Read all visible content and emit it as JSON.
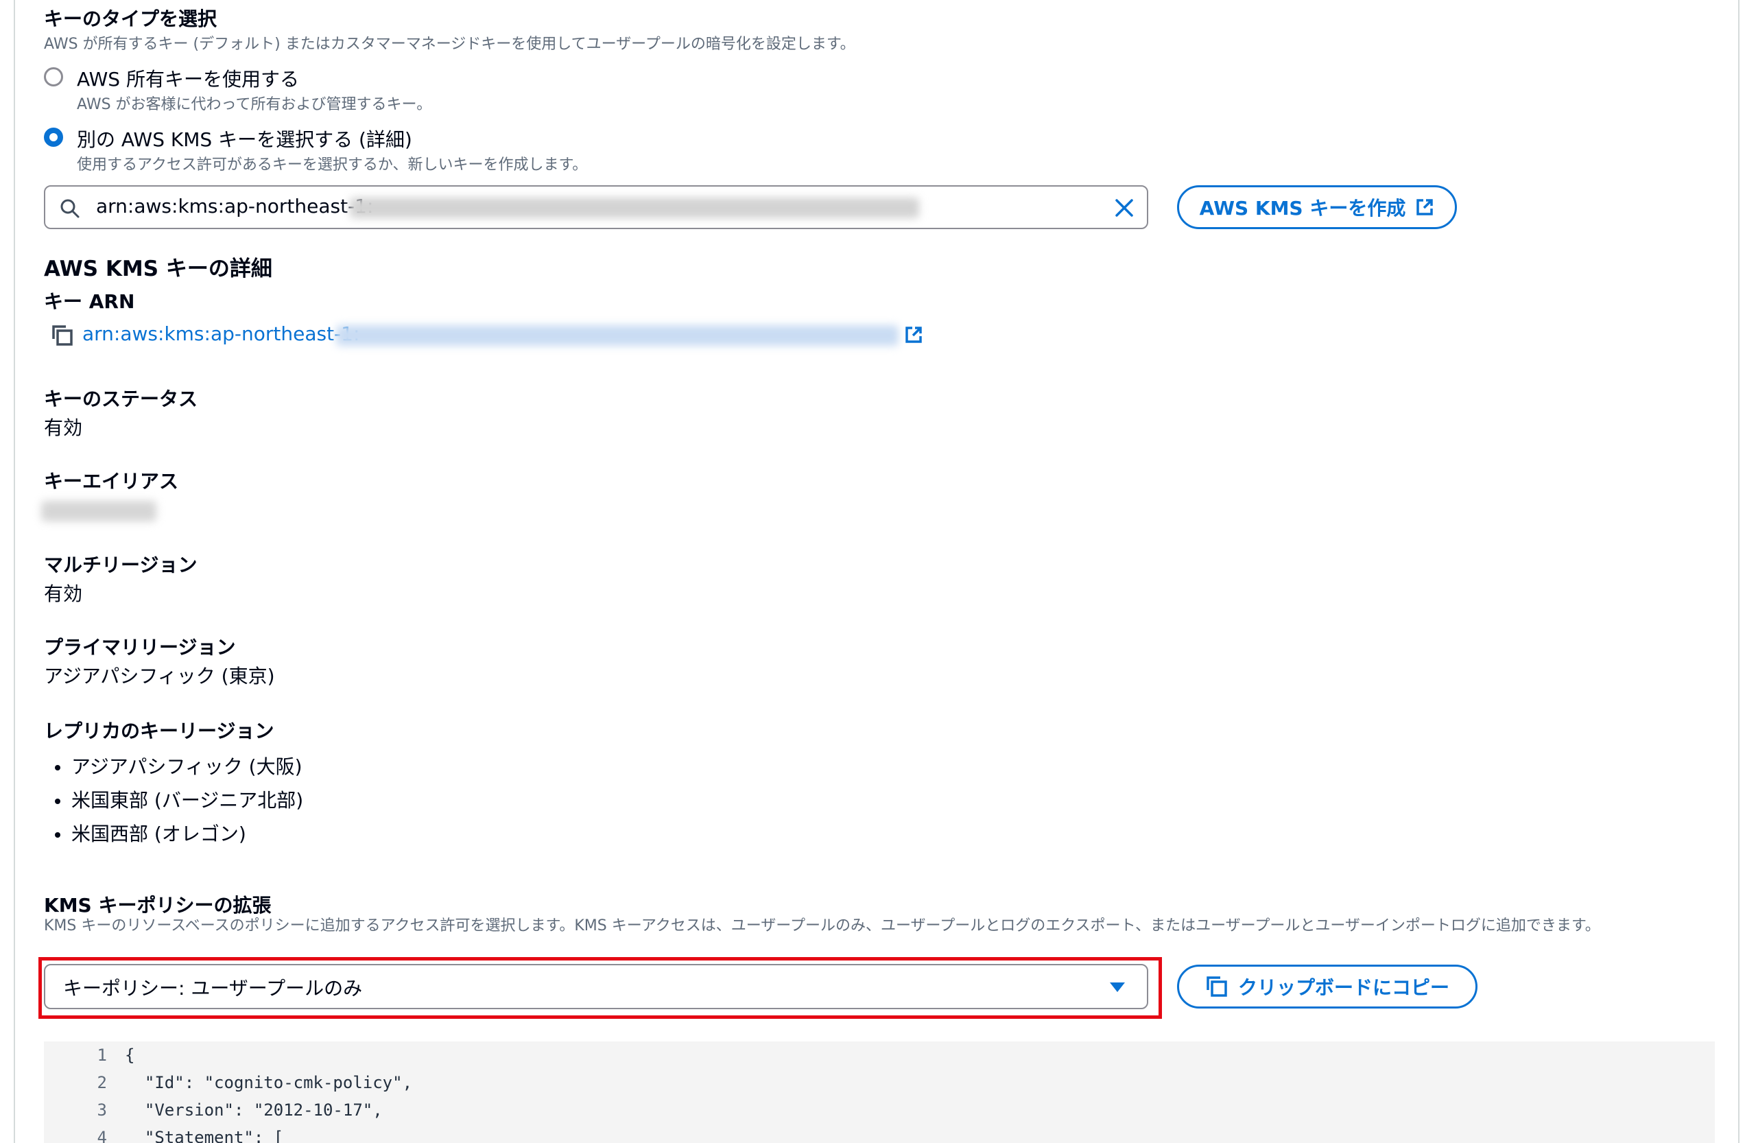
{
  "key_type": {
    "title": "キーのタイプを選択",
    "description": "AWS が所有するキー (デフォルト) またはカスタマーマネージドキーを使用してユーザープールの暗号化を設定します。",
    "options": [
      {
        "label": "AWS 所有キーを使用する",
        "description": "AWS がお客様に代わって所有および管理するキー。",
        "selected": false
      },
      {
        "label": "別の AWS KMS キーを選択する (詳細)",
        "description": "使用するアクセス許可があるキーを選択するか、新しいキーを作成します。",
        "selected": true
      }
    ]
  },
  "search": {
    "value": "arn:aws:kms:ap-northeast-1:",
    "icon": "search-icon",
    "clear_icon": "close-icon"
  },
  "create_key_button": {
    "label": "AWS KMS キーを作成",
    "icon": "external-link-icon"
  },
  "key_details": {
    "title": "AWS KMS キーの詳細",
    "arn_label": "キー ARN",
    "arn_value": "arn:aws:kms:ap-northeast-1:",
    "status_label": "キーのステータス",
    "status_value": "有効",
    "alias_label": "キーエイリアス",
    "multiregion_label": "マルチリージョン",
    "multiregion_value": "有効",
    "primary_region_label": "プライマリリージョン",
    "primary_region_value": "アジアパシフィック (東京)",
    "replica_label": "レプリカのキーリージョン",
    "replica_regions": [
      "アジアパシフィック (大阪)",
      "米国東部 (バージニア北部)",
      "米国西部 (オレゴン)"
    ]
  },
  "policy": {
    "title": "KMS キーポリシーの拡張",
    "description": "KMS キーのリソースベースのポリシーに追加するアクセス許可を選択します。KMS キーアクセスは、ユーザープールのみ、ユーザープールとログのエクスポート、またはユーザープールとユーザーインポートログに追加できます。",
    "select_value": "キーポリシー: ユーザープールのみ",
    "copy_button": "クリップボードにコピー"
  },
  "code": [
    {
      "n": "1",
      "text": "{"
    },
    {
      "n": "2",
      "text": "  \"Id\": \"cognito-cmk-policy\","
    },
    {
      "n": "3",
      "text": "  \"Version\": \"2012-10-17\","
    },
    {
      "n": "4",
      "text": "  \"Statement\": ["
    }
  ],
  "colors": {
    "accent": "#0972d3",
    "highlight_frame": "#e50914",
    "text": "#000716",
    "muted": "#5f6b7a"
  }
}
